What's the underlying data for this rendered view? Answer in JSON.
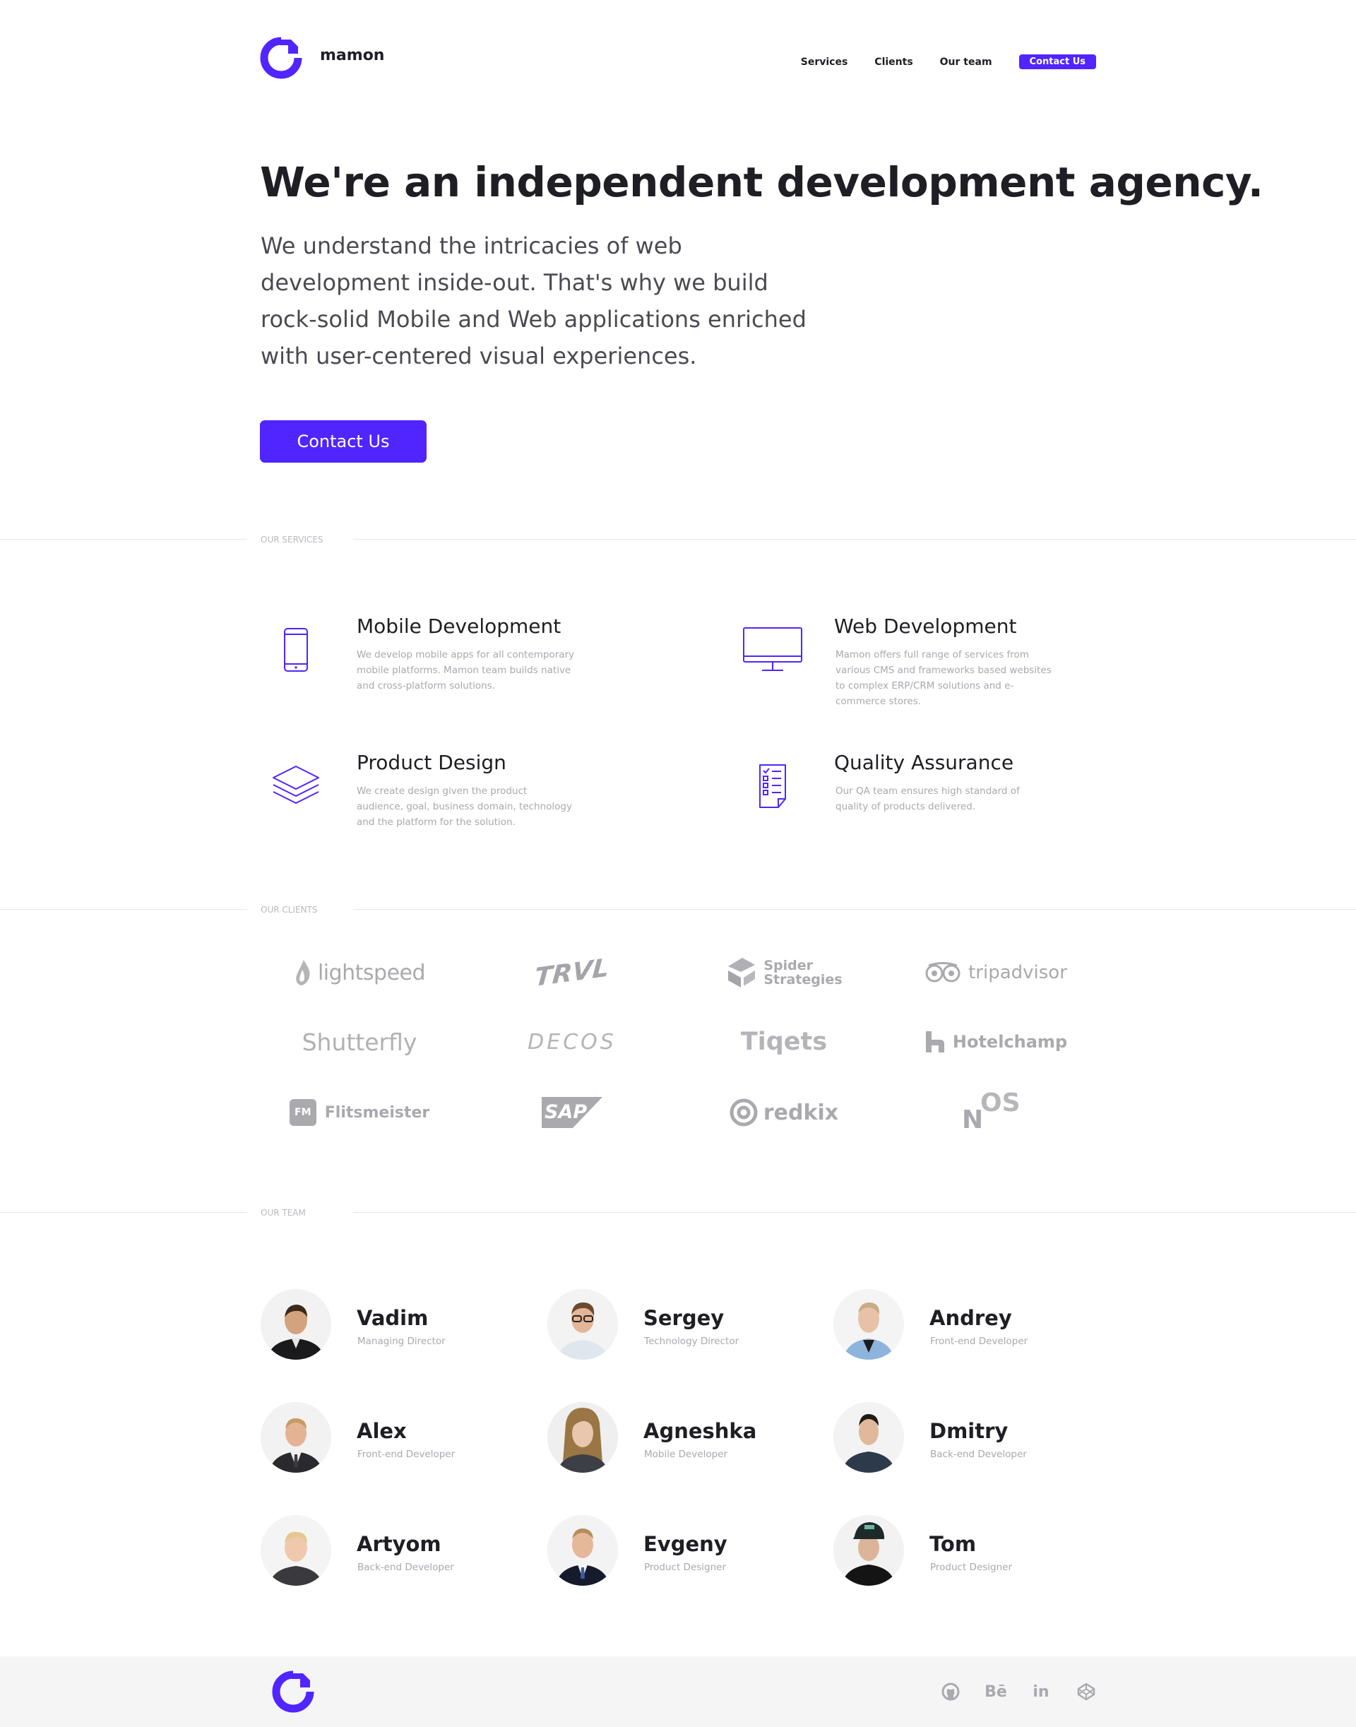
{
  "colors": {
    "accent": "#5025ff",
    "text": "#1e1e24",
    "muted": "#a8a8b0",
    "logo_gray": "#a9a9ae"
  },
  "header": {
    "brand": "mamon",
    "nav": [
      "Services",
      "Clients",
      "Our team"
    ],
    "cta": "Contact Us"
  },
  "hero": {
    "title": "We're an independent development agency.",
    "text": "We understand the intricacies of web development inside-out. That's why we build rock-solid Mobile and Web applications enriched with user-centered visual experiences.",
    "button": "Contact Us"
  },
  "sections": {
    "services": "OUR SERVICES",
    "clients": "OUR CLIENTS",
    "team": "OUR TEAM"
  },
  "services": [
    {
      "icon": "smartphone-icon",
      "title": "Mobile Development",
      "desc": "We develop mobile apps for all contemporary mobile platforms. Mamon team builds native and cross-platform solutions."
    },
    {
      "icon": "monitor-icon",
      "title": "Web Development",
      "desc": "Mamon offers full range of services from various CMS and frameworks based websites to complex ERP/CRM solutions and e-commerce stores."
    },
    {
      "icon": "layers-icon",
      "title": "Product Design",
      "desc": "We create design given the product audience, goal, business domain, technology and the platform for the solution."
    },
    {
      "icon": "checklist-icon",
      "title": "Quality Assurance",
      "desc": "Our QA team ensures high standard of quality of products delivered."
    }
  ],
  "clients": [
    "lightspeed",
    "TRVL",
    "Spider Strategies",
    "tripadvisor",
    "Shutterfly",
    "DECOS",
    "Tiqets",
    "Hotelchamp",
    "Flitsmeister",
    "SAP",
    "redkix",
    "NOS"
  ],
  "client_marks": {
    "spider": [
      "Spider",
      "Strategies"
    ],
    "fm": "FM",
    "nos": [
      "N",
      "OS"
    ]
  },
  "team": [
    {
      "name": "Vadim",
      "role": "Managing Director"
    },
    {
      "name": "Sergey",
      "role": "Technology Director"
    },
    {
      "name": "Andrey",
      "role": "Front-end Developer"
    },
    {
      "name": "Alex",
      "role": "Front-end Developer"
    },
    {
      "name": "Agneshka",
      "role": "Mobile Developer"
    },
    {
      "name": "Dmitry",
      "role": "Back-end Developer"
    },
    {
      "name": "Artyom",
      "role": "Back-end Developer"
    },
    {
      "name": "Evgeny",
      "role": "Product Designer"
    },
    {
      "name": "Tom",
      "role": "Product Designer"
    }
  ],
  "footer": {
    "socials": [
      "github-icon",
      "behance-icon",
      "linkedin-icon",
      "codepen-icon"
    ],
    "behance": "Bē",
    "linkedin": "in"
  }
}
